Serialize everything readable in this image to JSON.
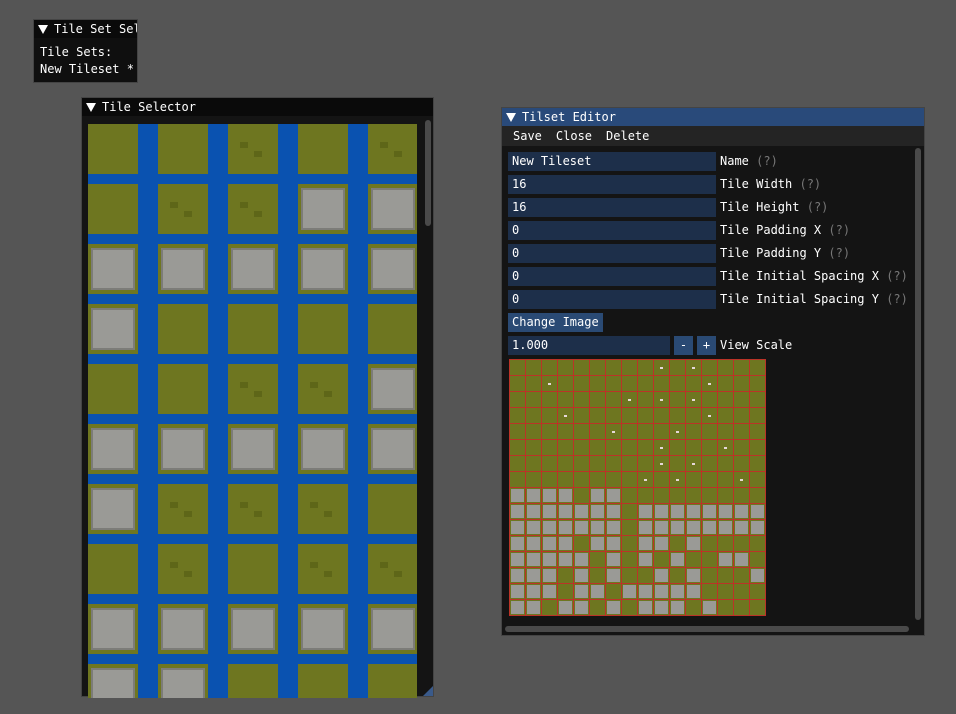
{
  "tileset_selector": {
    "title": "Tile Set Sel",
    "label": "Tile Sets:",
    "item": "New Tileset *"
  },
  "tile_selector": {
    "title": "Tile Selector"
  },
  "editor": {
    "title": "Tilset Editor",
    "menu": {
      "save": "Save",
      "close": "Close",
      "delete": "Delete"
    },
    "help": "(?)",
    "fields": [
      {
        "value": "New Tileset",
        "label": "Name"
      },
      {
        "value": "16",
        "label": "Tile Width"
      },
      {
        "value": "16",
        "label": "Tile Height"
      },
      {
        "value": "0",
        "label": "Tile Padding X"
      },
      {
        "value": "0",
        "label": "Tile Padding Y"
      },
      {
        "value": "0",
        "label": "Tile Initial Spacing X"
      },
      {
        "value": "0",
        "label": "Tile Initial Spacing Y"
      }
    ],
    "change_image": "Change Image",
    "scale_value": "1.000",
    "minus": "-",
    "plus": "+",
    "scale_label": "View Scale"
  }
}
